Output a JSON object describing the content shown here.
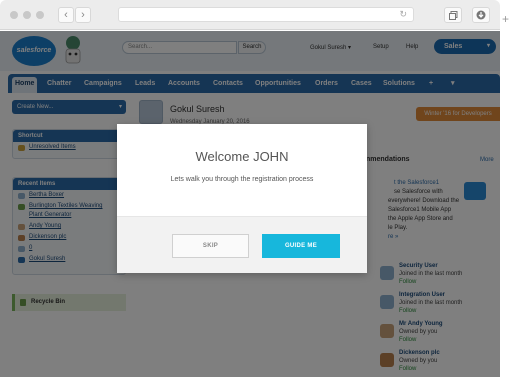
{
  "browser": {
    "back_glyph": "‹",
    "forward_glyph": "›",
    "reload_glyph": "↻",
    "tabs_icon": "tabs-icon",
    "download_icon": "download-icon",
    "new_tab_glyph": "+"
  },
  "header": {
    "logo_text": "salesforce",
    "search_placeholder": "Search...",
    "search_button": "Search",
    "user_menu": "Gokul Suresh",
    "user_menu_caret": "▾",
    "setup_link": "Setup",
    "help_link": "Help",
    "app_menu": "Sales",
    "app_menu_caret": "▾"
  },
  "tabs": [
    {
      "label": "Home"
    },
    {
      "label": "Chatter"
    },
    {
      "label": "Campaigns"
    },
    {
      "label": "Leads"
    },
    {
      "label": "Accounts"
    },
    {
      "label": "Contacts"
    },
    {
      "label": "Opportunities"
    },
    {
      "label": "Orders"
    },
    {
      "label": "Cases"
    },
    {
      "label": "Solutions"
    },
    {
      "label": "+"
    },
    {
      "label": "▾"
    }
  ],
  "sidebar": {
    "create_new": "Create New...",
    "create_caret": "▾",
    "shortcut_title": "Shortcut",
    "shortcut_items": [
      "Unresolved Items"
    ],
    "recent_title": "Recent Items",
    "recent_items": [
      "Bertha Boxer",
      "Burlington Textiles Weaving",
      "Plant Generator",
      "Andy Young",
      "Dickenson plc",
      "0",
      "Gokul Suresh"
    ],
    "recycle_bin": "Recycle Bin"
  },
  "main": {
    "user_name": "Gokul Suresh",
    "date": "Wednesday January 20, 2016",
    "promo": "Winter '16 for Developers"
  },
  "recommendations": {
    "title": "Recommendations",
    "title_visible": "nmendations",
    "more": "More",
    "card_heading": "t the Salesforce1",
    "card_lines": [
      "se Salesforce with",
      "everywhere! Download the",
      "Salesforce1 Mobile App",
      "the Apple App Store and",
      "le Play."
    ],
    "card_link": "re »",
    "people": [
      {
        "name": "Security User",
        "sub": "Joined in the last month",
        "follow": "Follow",
        "color": "#8fb0cf"
      },
      {
        "name": "Integration User",
        "sub": "Joined in the last month",
        "follow": "Follow",
        "color": "#8fb0cf"
      },
      {
        "name": "Mr Andy Young",
        "sub": "Owned by you",
        "follow": "Follow",
        "color": "#c9a27a"
      },
      {
        "name": "Dickenson plc",
        "sub": "Owned by you",
        "follow": "Follow",
        "color": "#b9814f"
      }
    ]
  },
  "modal": {
    "title": "Welcome JOHN",
    "subtitle": "Lets walk you through the registration process",
    "skip_label": "SKIP",
    "guide_label": "GUIDE ME"
  },
  "colors": {
    "accent": "#17b7dc",
    "salesforce_blue": "#2a6aa8",
    "promo_orange": "#e08a38"
  }
}
